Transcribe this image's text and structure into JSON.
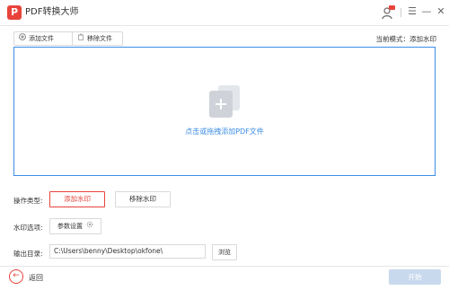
{
  "window": {
    "title": "PDF转换大师",
    "logo_glyph": "P",
    "icons": [
      "user-icon",
      "menu-icon",
      "minimize-icon",
      "close-icon"
    ],
    "vip_badge": "VIP"
  },
  "toolbar": {
    "add_file_label": "添加文件",
    "remove_file_label": "移除文件",
    "mode_text": "当前模式：添加水印"
  },
  "dropzone": {
    "hint": "点击或拖拽添加PDF文件"
  },
  "operation": {
    "label": "操作类型:",
    "add_watermark_label": "添加水印",
    "remove_watermark_label": "移除水印",
    "selected": "添加水印"
  },
  "watermark_options": {
    "label": "水印选项:",
    "params_label": "参数设置"
  },
  "output": {
    "label": "输出目录:",
    "path": "C:\\Users\\benny\\Desktop\\okfone\\",
    "browse_label": "浏览"
  },
  "footer": {
    "back_label": "返回",
    "start_label": "开始"
  },
  "colors": {
    "brand_red": "#e8433b",
    "accent_blue": "#3a8ee6",
    "disabled_blue": "#c8d9ee"
  }
}
